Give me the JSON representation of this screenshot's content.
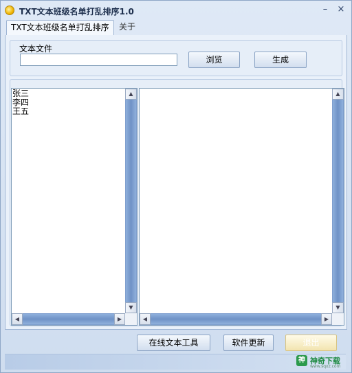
{
  "window": {
    "title": "TXT文本班级名单打乱排序1.0",
    "minimize_glyph": "–",
    "close_glyph": "×"
  },
  "tabs": [
    {
      "label": "TXT文本班级名单打乱排序",
      "active": true
    },
    {
      "label": "关于",
      "active": false
    }
  ],
  "file_section": {
    "label": "文本文件",
    "path_value": "",
    "browse_label": "浏览",
    "generate_label": "生成"
  },
  "source_list": {
    "items": [
      "张三",
      "李四",
      "王五"
    ]
  },
  "result_list": {
    "items": []
  },
  "bottom_buttons": {
    "online_tools_label": "在线文本工具",
    "update_label": "软件更新",
    "exit_label": "退出"
  },
  "watermark": {
    "logo_glyph": "神",
    "text": "神奇下载",
    "sub": "www.sqxz.com"
  },
  "colors": {
    "scroll_track": "#7f9fcf",
    "titlebar_text": "#1e2f4d",
    "watermark_green": "#1e8a42"
  }
}
